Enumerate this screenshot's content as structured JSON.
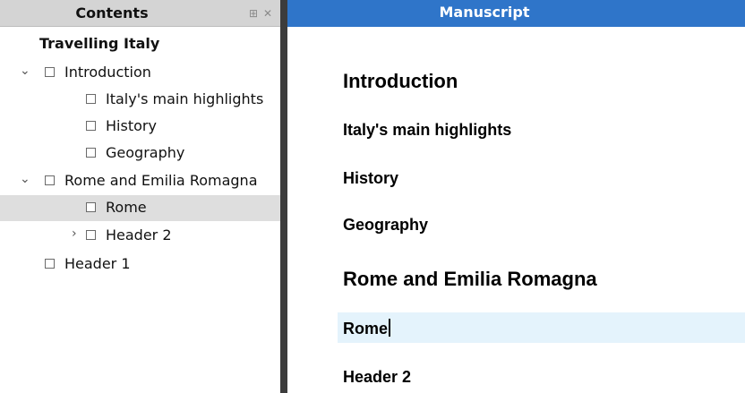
{
  "contents": {
    "title": "Contents",
    "pin_icon": "pin-icon",
    "close_icon": "close-icon",
    "tree": {
      "root": "Travelling Italy",
      "items": [
        {
          "label": "Introduction",
          "expanded": true
        },
        {
          "label": "Italy's main highlights"
        },
        {
          "label": "History"
        },
        {
          "label": "Geography"
        },
        {
          "label": "Rome and Emilia Romagna",
          "expanded": true
        },
        {
          "label": "Rome",
          "selected": true
        },
        {
          "label": "Header 2",
          "expanded": false
        },
        {
          "label": "Header 1"
        }
      ]
    }
  },
  "manuscript": {
    "title": "Manuscript",
    "headings": [
      {
        "text": "Introduction",
        "level": 1
      },
      {
        "text": "Italy's main highlights",
        "level": 2
      },
      {
        "text": "History",
        "level": 2
      },
      {
        "text": "Geography",
        "level": 2
      },
      {
        "text": "Rome and Emilia Romagna",
        "level": 1
      },
      {
        "text": "Rome",
        "level": 2,
        "active": true
      },
      {
        "text": "Header 2",
        "level": 2
      }
    ]
  },
  "colors": {
    "manuscript_header_bg": "#2f75c9",
    "contents_header_bg": "#d4d4d4",
    "selected_row_bg": "#dedede",
    "active_line_bg": "#e4f3fc",
    "splitter": "#3c3c3c"
  }
}
